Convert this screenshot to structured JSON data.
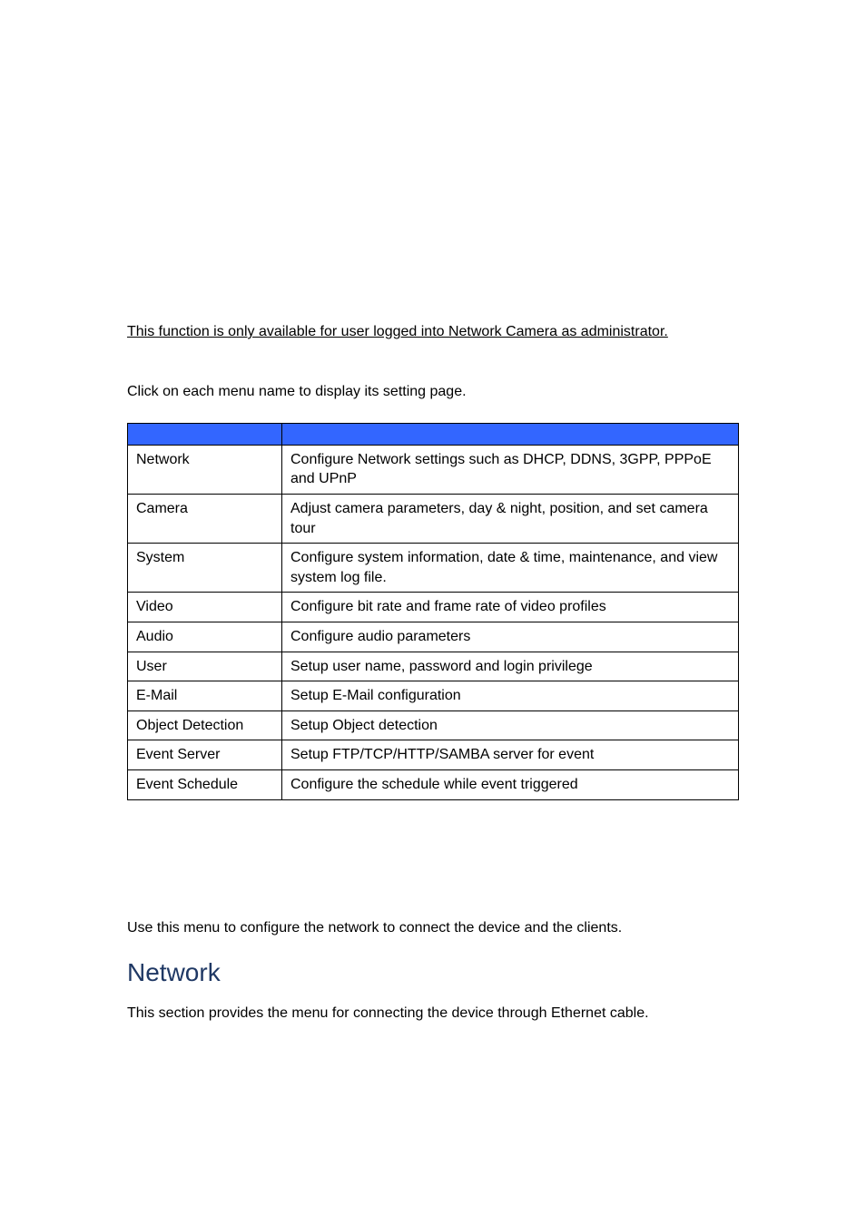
{
  "admin_note": "This function is only available for user logged into Network Camera as administrator.",
  "instruction": "Click on each menu name to display its setting page.",
  "rows": [
    {
      "label": "Network",
      "desc": "Configure Network settings such as DHCP, DDNS, 3GPP, PPPoE and UPnP"
    },
    {
      "label": "Camera",
      "desc": "Adjust camera parameters, day & night, position, and set camera tour"
    },
    {
      "label": "System",
      "desc": "Configure system information, date & time, maintenance, and view system log file."
    },
    {
      "label": "Video",
      "desc": "Configure bit rate and frame rate of video profiles"
    },
    {
      "label": "Audio",
      "desc": "Configure audio parameters"
    },
    {
      "label": "User",
      "desc": "Setup user name, password and login privilege"
    },
    {
      "label": "E-Mail",
      "desc": "Setup E-Mail configuration"
    },
    {
      "label": "Object Detection",
      "desc": "Setup Object detection"
    },
    {
      "label": "Event Server",
      "desc": "Setup FTP/TCP/HTTP/SAMBA server for event"
    },
    {
      "label": "Event Schedule",
      "desc": "Configure the schedule while event triggered"
    }
  ],
  "network_intro": "Use this menu to configure the network to connect the device and the clients.",
  "network_heading": "Network",
  "network_desc": "This section provides the menu for connecting the device through Ethernet cable."
}
